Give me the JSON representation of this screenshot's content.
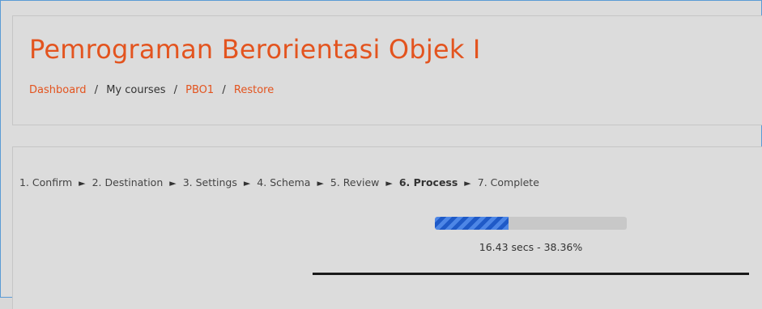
{
  "header": {
    "title": "Pemrograman Berorientasi Objek I",
    "breadcrumb": [
      {
        "label": "Dashboard",
        "link": true
      },
      {
        "label": "My courses",
        "link": false
      },
      {
        "label": "PBO1",
        "link": true
      },
      {
        "label": "Restore",
        "link": true
      }
    ],
    "separator": "/"
  },
  "restore": {
    "steps": [
      {
        "label": "1. Confirm"
      },
      {
        "label": "2. Destination"
      },
      {
        "label": "3. Settings"
      },
      {
        "label": "4. Schema"
      },
      {
        "label": "5. Review"
      },
      {
        "label": "6. Process"
      },
      {
        "label": "7. Complete"
      }
    ],
    "step_arrow": "►",
    "progress": {
      "percent": 38.36,
      "text": "16.43 secs - 38.36%"
    }
  },
  "colors": {
    "accent": "#e3541f",
    "progress_fill": "#2866d0",
    "page_background": "#dcdcdc",
    "frame_border": "#5b9bd5"
  }
}
